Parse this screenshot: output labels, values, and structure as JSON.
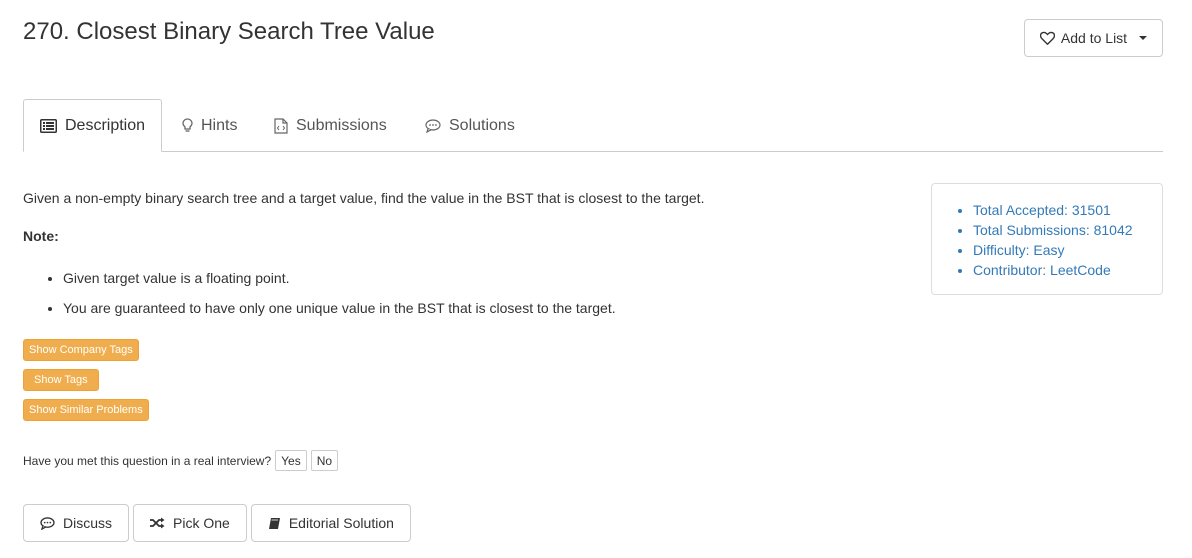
{
  "problem": {
    "title": "270. Closest Binary Search Tree Value",
    "add_to_list": "Add to List"
  },
  "tabs": [
    {
      "label": "Description",
      "icon": "list-icon",
      "active": true
    },
    {
      "label": "Hints",
      "icon": "lightbulb-icon",
      "active": false
    },
    {
      "label": "Submissions",
      "icon": "code-file-icon",
      "active": false
    },
    {
      "label": "Solutions",
      "icon": "chat-bubble-icon",
      "active": false
    }
  ],
  "content": {
    "description": "Given a non-empty binary search tree and a target value, find the value in the BST that is closest to the target.",
    "note_label": "Note:",
    "notes": [
      "Given target value is a floating point.",
      "You are guaranteed to have only one unique value in the BST that is closest to the target."
    ]
  },
  "tag_buttons": {
    "company": "Show Company Tags",
    "tags": "Show Tags",
    "similar": "Show Similar Problems"
  },
  "interview": {
    "question": "Have you met this question in a real interview?",
    "yes": "Yes",
    "no": "No"
  },
  "actions": {
    "discuss": "Discuss",
    "pick_one": "Pick One",
    "editorial": "Editorial Solution"
  },
  "stats": {
    "accepted": "Total Accepted: 31501",
    "submissions": "Total Submissions: 81042",
    "difficulty": "Difficulty: Easy",
    "contributor": "Contributor: LeetCode"
  },
  "colors": {
    "tag_button": "#f0ad4e",
    "link": "#337ab7"
  }
}
